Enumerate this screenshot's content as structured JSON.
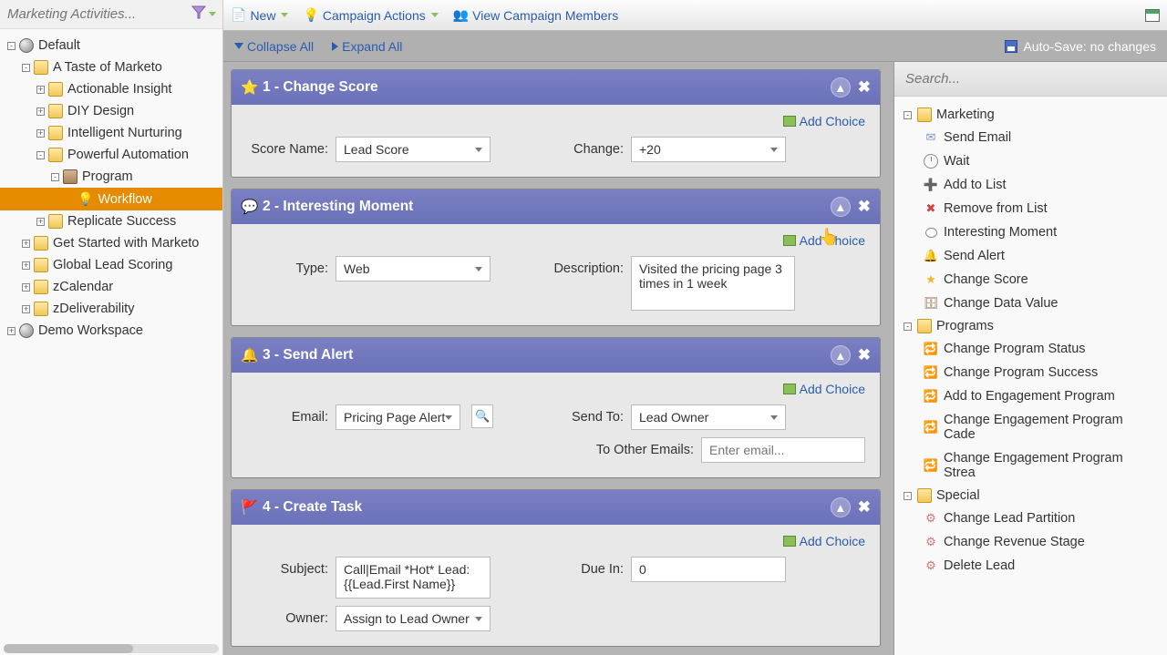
{
  "left_panel": {
    "search_placeholder": "Marketing Activities...",
    "tree": [
      {
        "level": 0,
        "toggle": "-",
        "icon": "globe",
        "label": "Default"
      },
      {
        "level": 1,
        "toggle": "-",
        "icon": "folder",
        "label": "A Taste of Marketo"
      },
      {
        "level": 2,
        "toggle": "+",
        "icon": "folder",
        "label": "Actionable Insight"
      },
      {
        "level": 2,
        "toggle": "+",
        "icon": "folder",
        "label": "DIY Design"
      },
      {
        "level": 2,
        "toggle": "+",
        "icon": "folder",
        "label": "Intelligent Nurturing"
      },
      {
        "level": 2,
        "toggle": "-",
        "icon": "folder",
        "label": "Powerful Automation"
      },
      {
        "level": 3,
        "toggle": "-",
        "icon": "program",
        "label": "Program"
      },
      {
        "level": 4,
        "toggle": "",
        "icon": "bulb",
        "label": "Workflow",
        "selected": true
      },
      {
        "level": 2,
        "toggle": "+",
        "icon": "folder",
        "label": "Replicate Success"
      },
      {
        "level": 1,
        "toggle": "+",
        "icon": "folder",
        "label": "Get Started with Marketo"
      },
      {
        "level": 1,
        "toggle": "+",
        "icon": "folder",
        "label": "Global Lead Scoring"
      },
      {
        "level": 1,
        "toggle": "+",
        "icon": "folder",
        "label": "zCalendar"
      },
      {
        "level": 1,
        "toggle": "+",
        "icon": "folder",
        "label": "zDeliverability"
      },
      {
        "level": 0,
        "toggle": "+",
        "icon": "globe",
        "label": "Demo Workspace"
      }
    ]
  },
  "toolbar": {
    "new": "New",
    "campaign_actions": "Campaign Actions",
    "view_members": "View Campaign Members"
  },
  "subbar": {
    "collapse_all": "Collapse All",
    "expand_all": "Expand All",
    "autosave": "Auto-Save: no changes"
  },
  "steps": [
    {
      "icon": "star",
      "title": "1 - Change Score",
      "add_choice": "Add Choice",
      "fields": [
        {
          "label": "Score Name:",
          "type": "select",
          "value": "Lead Score"
        },
        {
          "label": "Change:",
          "type": "select",
          "value": "+20"
        }
      ]
    },
    {
      "icon": "bubble",
      "title": "2 - Interesting Moment",
      "add_choice": "Add Choice",
      "fields": [
        {
          "label": "Type:",
          "type": "select",
          "value": "Web"
        },
        {
          "label": "Description:",
          "type": "textarea",
          "value": "Visited the pricing page 3 times in 1 week"
        }
      ]
    },
    {
      "icon": "bell",
      "title": "3 - Send Alert",
      "add_choice": "Add Choice",
      "fields": [
        {
          "label": "Email:",
          "type": "select_preview",
          "value": "Pricing Page Alert"
        },
        {
          "label": "Send To:",
          "type": "select",
          "value": "Lead Owner"
        },
        {
          "label": "To Other Emails:",
          "type": "input",
          "placeholder": "Enter email...",
          "full_right": true
        }
      ]
    },
    {
      "icon": "flag",
      "title": "4 - Create Task",
      "add_choice": "Add Choice",
      "fields": [
        {
          "label": "Subject:",
          "type": "textarea_narrow",
          "value": "Call|Email *Hot* Lead: {{Lead.First Name}}"
        },
        {
          "label": "Due In:",
          "type": "input_num",
          "value": "0"
        },
        {
          "label": "Owner:",
          "type": "select",
          "value": "Assign to Lead Owner",
          "partial": true
        }
      ]
    }
  ],
  "right_panel": {
    "search_placeholder": "Search...",
    "groups": [
      {
        "toggle": "-",
        "icon": "marketing",
        "label": "Marketing",
        "items": [
          {
            "icon": "env",
            "label": "Send Email"
          },
          {
            "icon": "clock",
            "label": "Wait"
          },
          {
            "icon": "list-add",
            "label": "Add to List"
          },
          {
            "icon": "list-rem",
            "label": "Remove from List"
          },
          {
            "icon": "bubble",
            "label": "Interesting Moment"
          },
          {
            "icon": "bell",
            "label": "Send Alert"
          },
          {
            "icon": "star",
            "label": "Change Score"
          },
          {
            "icon": "db",
            "label": "Change Data Value"
          }
        ]
      },
      {
        "toggle": "-",
        "icon": "programs",
        "label": "Programs",
        "items": [
          {
            "icon": "prog-ic",
            "label": "Change Program Status"
          },
          {
            "icon": "prog-ic",
            "label": "Change Program Success"
          },
          {
            "icon": "prog-ic",
            "label": "Add to Engagement Program"
          },
          {
            "icon": "prog-ic",
            "label": "Change Engagement Program Cade"
          },
          {
            "icon": "prog-ic",
            "label": "Change Engagement Program Strea"
          }
        ]
      },
      {
        "toggle": "-",
        "icon": "special",
        "label": "Special",
        "items": [
          {
            "icon": "spec-ic",
            "label": "Change Lead Partition"
          },
          {
            "icon": "spec-ic",
            "label": "Change Revenue Stage"
          },
          {
            "icon": "spec-ic",
            "label": "Delete Lead"
          }
        ]
      }
    ]
  }
}
